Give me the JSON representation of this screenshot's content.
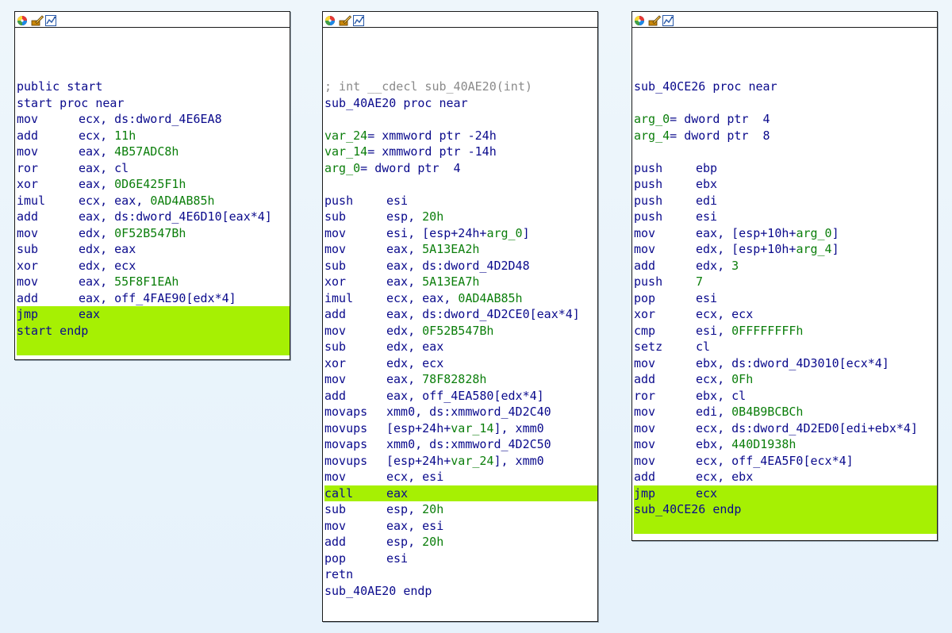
{
  "icons": [
    "color-wheel-icon",
    "edit-icon",
    "graph-icon"
  ],
  "nodes": [
    {
      "id": "start",
      "lines": [
        {
          "type": "label",
          "text": "public start"
        },
        {
          "type": "label",
          "text": "start proc near"
        },
        {
          "type": "ins",
          "mn": "mov",
          "op": "ecx, ds:dword_4E6EA8"
        },
        {
          "type": "ins",
          "mn": "add",
          "op": "ecx, ",
          "num": "11h"
        },
        {
          "type": "ins",
          "mn": "mov",
          "op": "eax, ",
          "num": "4B57ADC8h"
        },
        {
          "type": "ins",
          "mn": "ror",
          "op": "eax, cl"
        },
        {
          "type": "ins",
          "mn": "xor",
          "op": "eax, ",
          "num": "0D6E425F1h"
        },
        {
          "type": "ins",
          "mn": "imul",
          "op": "ecx, eax, ",
          "num": "0AD4AB85h"
        },
        {
          "type": "ins",
          "mn": "add",
          "op": "eax, ds:dword_4E6D10[eax*4]"
        },
        {
          "type": "ins",
          "mn": "mov",
          "op": "edx, ",
          "num": "0F52B547Bh"
        },
        {
          "type": "ins",
          "mn": "sub",
          "op": "edx, eax"
        },
        {
          "type": "ins",
          "mn": "xor",
          "op": "edx, ecx"
        },
        {
          "type": "ins",
          "mn": "mov",
          "op": "eax, ",
          "num": "55F8F1EAh"
        },
        {
          "type": "ins",
          "mn": "add",
          "op": "eax, off_4FAE90[edx*4]"
        },
        {
          "type": "ins",
          "mn": "jmp",
          "op": "eax",
          "hl": true
        },
        {
          "type": "label",
          "text": "start endp",
          "hl": true
        },
        {
          "type": "blank",
          "hl": true
        }
      ]
    },
    {
      "id": "sub_40AE20",
      "lines": [
        {
          "type": "comment",
          "text": "; int __cdecl sub_40AE20(int)"
        },
        {
          "type": "label",
          "text": "sub_40AE20 proc near"
        },
        {
          "type": "blank"
        },
        {
          "type": "var",
          "name": "var_24",
          "rest": "= xmmword ptr -24h"
        },
        {
          "type": "var",
          "name": "var_14",
          "rest": "= xmmword ptr -14h"
        },
        {
          "type": "var",
          "name": "arg_0",
          "rest": "= dword ptr  4"
        },
        {
          "type": "blank"
        },
        {
          "type": "ins",
          "mn": "push",
          "op": "esi"
        },
        {
          "type": "ins",
          "mn": "sub",
          "op": "esp, ",
          "num": "20h"
        },
        {
          "type": "ins",
          "mn": "mov",
          "op": "esi, [esp+24h+",
          "var": "arg_0",
          "post": "]"
        },
        {
          "type": "ins",
          "mn": "mov",
          "op": "eax, ",
          "num": "5A13EA2h"
        },
        {
          "type": "ins",
          "mn": "sub",
          "op": "eax, ds:dword_4D2D48"
        },
        {
          "type": "ins",
          "mn": "xor",
          "op": "eax, ",
          "num": "5A13EA7h"
        },
        {
          "type": "ins",
          "mn": "imul",
          "op": "ecx, eax, ",
          "num": "0AD4AB85h"
        },
        {
          "type": "ins",
          "mn": "add",
          "op": "eax, ds:dword_4D2CE0[eax*4]"
        },
        {
          "type": "ins",
          "mn": "mov",
          "op": "edx, ",
          "num": "0F52B547Bh"
        },
        {
          "type": "ins",
          "mn": "sub",
          "op": "edx, eax"
        },
        {
          "type": "ins",
          "mn": "xor",
          "op": "edx, ecx"
        },
        {
          "type": "ins",
          "mn": "mov",
          "op": "eax, ",
          "num": "78F82828h"
        },
        {
          "type": "ins",
          "mn": "add",
          "op": "eax, off_4EA580[edx*4]"
        },
        {
          "type": "ins",
          "mn": "movaps",
          "op": "xmm0, ds:xmmword_4D2C40"
        },
        {
          "type": "ins",
          "mn": "movups",
          "op": "[esp+24h+",
          "var": "var_14",
          "post": "], xmm0"
        },
        {
          "type": "ins",
          "mn": "movaps",
          "op": "xmm0, ds:xmmword_4D2C50"
        },
        {
          "type": "ins",
          "mn": "movups",
          "op": "[esp+24h+",
          "var": "var_24",
          "post": "], xmm0"
        },
        {
          "type": "ins",
          "mn": "mov",
          "op": "ecx, esi"
        },
        {
          "type": "ins",
          "mn": "call",
          "op": "eax",
          "hl": true
        },
        {
          "type": "ins",
          "mn": "sub",
          "op": "esp, ",
          "num": "20h"
        },
        {
          "type": "ins",
          "mn": "mov",
          "op": "eax, esi"
        },
        {
          "type": "ins",
          "mn": "add",
          "op": "esp, ",
          "num": "20h"
        },
        {
          "type": "ins",
          "mn": "pop",
          "op": "esi"
        },
        {
          "type": "ins",
          "mn": "retn",
          "op": ""
        },
        {
          "type": "label",
          "text": "sub_40AE20 endp"
        }
      ]
    },
    {
      "id": "sub_40CE26",
      "lines": [
        {
          "type": "label",
          "text": "sub_40CE26 proc near"
        },
        {
          "type": "blank"
        },
        {
          "type": "var",
          "name": "arg_0",
          "rest": "= dword ptr  4"
        },
        {
          "type": "var",
          "name": "arg_4",
          "rest": "= dword ptr  8"
        },
        {
          "type": "blank"
        },
        {
          "type": "ins",
          "mn": "push",
          "op": "ebp"
        },
        {
          "type": "ins",
          "mn": "push",
          "op": "ebx"
        },
        {
          "type": "ins",
          "mn": "push",
          "op": "edi"
        },
        {
          "type": "ins",
          "mn": "push",
          "op": "esi"
        },
        {
          "type": "ins",
          "mn": "mov",
          "op": "eax, [esp+10h+",
          "var": "arg_0",
          "post": "]"
        },
        {
          "type": "ins",
          "mn": "mov",
          "op": "edx, [esp+10h+",
          "var": "arg_4",
          "post": "]"
        },
        {
          "type": "ins",
          "mn": "add",
          "op": "edx, ",
          "num": "3"
        },
        {
          "type": "ins",
          "mn": "push",
          "op": "",
          "num": "7"
        },
        {
          "type": "ins",
          "mn": "pop",
          "op": "esi"
        },
        {
          "type": "ins",
          "mn": "xor",
          "op": "ecx, ecx"
        },
        {
          "type": "ins",
          "mn": "cmp",
          "op": "esi, ",
          "num": "0FFFFFFFFh"
        },
        {
          "type": "ins",
          "mn": "setz",
          "op": "cl"
        },
        {
          "type": "ins",
          "mn": "mov",
          "op": "ebx, ds:dword_4D3010[ecx*4]"
        },
        {
          "type": "ins",
          "mn": "add",
          "op": "ecx, ",
          "num": "0Fh"
        },
        {
          "type": "ins",
          "mn": "ror",
          "op": "ebx, cl"
        },
        {
          "type": "ins",
          "mn": "mov",
          "op": "edi, ",
          "num": "0B4B9BCBCh"
        },
        {
          "type": "ins",
          "mn": "mov",
          "op": "ecx, ds:dword_4D2ED0[edi+ebx*4]"
        },
        {
          "type": "ins",
          "mn": "mov",
          "op": "ebx, ",
          "num": "440D1938h"
        },
        {
          "type": "ins",
          "mn": "mov",
          "op": "ecx, off_4EA5F0[ecx*4]"
        },
        {
          "type": "ins",
          "mn": "add",
          "op": "ecx, ebx"
        },
        {
          "type": "ins",
          "mn": "jmp",
          "op": "ecx",
          "hl": true
        },
        {
          "type": "label",
          "text": "sub_40CE26 endp",
          "hl": true
        },
        {
          "type": "blank",
          "hl": true
        }
      ]
    }
  ]
}
